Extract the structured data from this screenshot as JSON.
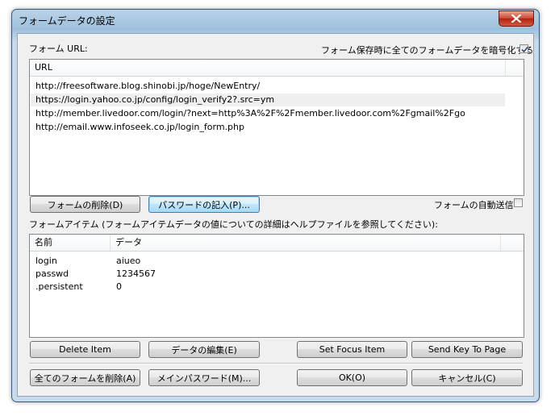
{
  "window": {
    "title": "フォームデータの設定"
  },
  "url_section": {
    "label": "フォーム URL:",
    "encrypt_checkbox_label": "フォーム保存時に全てのフォームデータを暗号化する",
    "encrypt_checked": true,
    "column_header": "URL",
    "urls": [
      "http://freesoftware.blog.shinobi.jp/hoge/NewEntry/",
      "https://login.yahoo.co.jp/config/login_verify2?.src=ym",
      "http://member.livedoor.com/login/?next=http%3A%2F%2Fmember.livedoor.com%2Fgmail%2Fgo",
      "http://email.www.infoseek.co.jp/login_form.php"
    ]
  },
  "form_buttons": {
    "delete_form": "フォームの削除(D)",
    "enter_password": "パスワードの記入(P)...",
    "auto_submit_label": "フォームの自動送信",
    "auto_submit_checked": false
  },
  "items_section": {
    "label": "フォームアイテム (フォームアイテムデータの値についての詳細はヘルプファイルを参照してください):",
    "columns": [
      "名前",
      "データ"
    ],
    "rows": [
      {
        "name": "login",
        "data": "aiueo"
      },
      {
        "name": "passwd",
        "data": "1234567"
      },
      {
        "name": ".persistent",
        "data": "0"
      }
    ]
  },
  "item_buttons": {
    "delete_item": "Delete Item",
    "edit_data": "データの編集(E)",
    "set_focus_item": "Set Focus Item",
    "send_key_to_page": "Send Key To Page"
  },
  "bottom_buttons": {
    "delete_all_forms": "全てのフォームを削除(A)",
    "main_password": "メインパスワード(M)...",
    "ok": "OK(O)",
    "cancel": "キャンセル(C)"
  }
}
